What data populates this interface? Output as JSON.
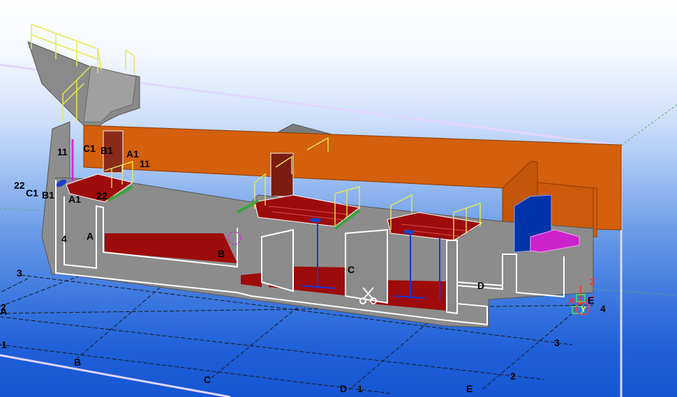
{
  "grid_labels": {
    "right_top": "11",
    "right_mid": "11",
    "left_top": "22",
    "left_mid": "22",
    "c1_top": "C1",
    "b1_top": "B1",
    "a1_top": "A1",
    "c1_left": "C1",
    "b1_left": "B1",
    "a1_left": "A1",
    "four_left": "4",
    "a_wall": "A",
    "b_wall": "B",
    "c_wall": "C",
    "d_wall": "D",
    "e_right": "E",
    "four_right": "4",
    "three_left": "3",
    "two_left": "2",
    "a_left": "A",
    "one_left": "1",
    "b_bottom": "B",
    "c_bottom": "C",
    "d_bottom": "D",
    "one_bottom": "1",
    "e_bottom": "E",
    "two_bottom": "2",
    "three_bottom": "3"
  },
  "axis": {
    "x": "X",
    "y": "Y",
    "z": "Z"
  },
  "colors": {
    "concrete": "#8a8a8a",
    "concrete_dark": "#6f6f6f",
    "wall_orange": "#d45f0c",
    "floor_red": "#9e0b0b",
    "railing": "#e9e94a",
    "equipment_blue": "#0033a8",
    "magenta_grating": "#cc22cc",
    "outline_white": "#ffffff"
  }
}
